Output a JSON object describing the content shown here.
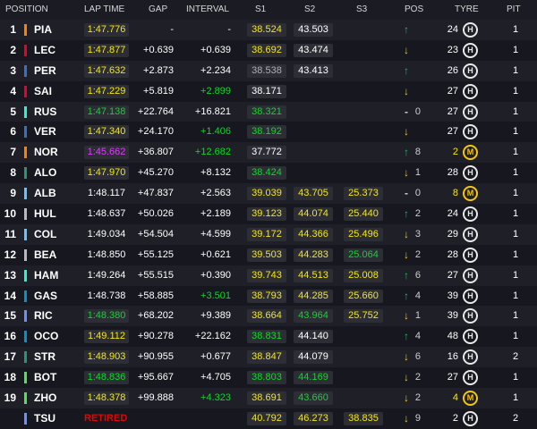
{
  "header": {
    "position": "POSITION",
    "lap_time": "LAP TIME",
    "gap": "GAP",
    "interval": "INTERVAL",
    "s1": "S1",
    "s2": "S2",
    "s3": "S3",
    "pos": "POS",
    "tyre": "TYRE",
    "pit": "PIT"
  },
  "colors": {
    "team": {
      "PIA": "#ff8000",
      "LEC": "#e8002d",
      "PER": "#3671c6",
      "SAI": "#e8002d",
      "RUS": "#27f4d2",
      "VER": "#3671c6",
      "NOR": "#ff8000",
      "ALO": "#229971",
      "ALB": "#64c4ff",
      "HUL": "#b6babd",
      "COL": "#64c4ff",
      "BEA": "#b6babd",
      "HAM": "#27f4d2",
      "GAS": "#0093cc",
      "RIC": "#6692ff",
      "OCO": "#0093cc",
      "STR": "#229971",
      "BOT": "#52e252",
      "ZHO": "#52e252",
      "TSU": "#6692ff"
    },
    "yellow": "#f5e900",
    "green": "#00e020",
    "purple": "#e03cff"
  },
  "rows": [
    {
      "pos": "1",
      "driver": "PIA",
      "lap": "1:47.776",
      "lap_c": "yellow",
      "gap": "-",
      "gap_c": "white",
      "int": "-",
      "int_c": "white",
      "s1": "38.524",
      "s1_c": "yellow",
      "s2": "43.503",
      "s2_c": "white",
      "s3": "",
      "s3_c": "white",
      "arrow": "↑",
      "dir": "up",
      "chg": "",
      "age": "24",
      "tyre": "H",
      "pit": "1"
    },
    {
      "pos": "2",
      "driver": "LEC",
      "lap": "1:47.877",
      "lap_c": "yellow",
      "gap": "+0.639",
      "gap_c": "white",
      "int": "+0.639",
      "int_c": "white",
      "s1": "38.692",
      "s1_c": "yellow",
      "s2": "43.474",
      "s2_c": "white",
      "s3": "",
      "s3_c": "white",
      "arrow": "↓",
      "dir": "down",
      "chg": "",
      "age": "23",
      "tyre": "H",
      "pit": "1"
    },
    {
      "pos": "3",
      "driver": "PER",
      "lap": "1:47.632",
      "lap_c": "yellow",
      "gap": "+2.873",
      "gap_c": "white",
      "int": "+2.234",
      "int_c": "white",
      "s1": "38.538",
      "s1_c": "gray",
      "s2": "43.413",
      "s2_c": "white",
      "s3": "",
      "s3_c": "white",
      "arrow": "↑",
      "dir": "up",
      "chg": "",
      "age": "26",
      "tyre": "H",
      "pit": "1"
    },
    {
      "pos": "4",
      "driver": "SAI",
      "lap": "1:47.229",
      "lap_c": "yellow",
      "gap": "+5.819",
      "gap_c": "white",
      "int": "+2.899",
      "int_c": "green",
      "s1": "38.171",
      "s1_c": "white",
      "s2": "",
      "s2_c": "white",
      "s3": "",
      "s3_c": "white",
      "arrow": "↓",
      "dir": "down",
      "chg": "",
      "age": "27",
      "tyre": "H",
      "pit": "1"
    },
    {
      "pos": "5",
      "driver": "RUS",
      "lap": "1:47.138",
      "lap_c": "green",
      "gap": "+22.764",
      "gap_c": "white",
      "int": "+16.821",
      "int_c": "white",
      "s1": "38.321",
      "s1_c": "green",
      "s2": "",
      "s2_c": "white",
      "s3": "",
      "s3_c": "white",
      "arrow": "-",
      "dir": "same",
      "chg": "0",
      "age": "27",
      "tyre": "H",
      "pit": "1"
    },
    {
      "pos": "6",
      "driver": "VER",
      "lap": "1:47.340",
      "lap_c": "yellow",
      "gap": "+24.170",
      "gap_c": "white",
      "int": "+1.406",
      "int_c": "green",
      "s1": "38.192",
      "s1_c": "green",
      "s2": "",
      "s2_c": "white",
      "s3": "",
      "s3_c": "white",
      "arrow": "↓",
      "dir": "down",
      "chg": "",
      "age": "27",
      "tyre": "H",
      "pit": "1"
    },
    {
      "pos": "7",
      "driver": "NOR",
      "lap": "1:45.662",
      "lap_c": "purple",
      "gap": "+36.807",
      "gap_c": "white",
      "int": "+12.682",
      "int_c": "green",
      "s1": "37.772",
      "s1_c": "white",
      "s2": "",
      "s2_c": "white",
      "s3": "",
      "s3_c": "white",
      "arrow": "↑",
      "dir": "up",
      "chg": "8",
      "age": "2",
      "tyre": "M",
      "pit": "1"
    },
    {
      "pos": "8",
      "driver": "ALO",
      "lap": "1:47.970",
      "lap_c": "yellow",
      "gap": "+45.270",
      "gap_c": "white",
      "int": "+8.132",
      "int_c": "white",
      "s1": "38.424",
      "s1_c": "green",
      "s2": "",
      "s2_c": "white",
      "s3": "",
      "s3_c": "white",
      "arrow": "↓",
      "dir": "down",
      "chg": "1",
      "age": "28",
      "tyre": "H",
      "pit": "1"
    },
    {
      "pos": "9",
      "driver": "ALB",
      "lap": "1:48.117",
      "lap_c": "white",
      "gap": "+47.837",
      "gap_c": "white",
      "int": "+2.563",
      "int_c": "white",
      "s1": "39.039",
      "s1_c": "yellow",
      "s2": "43.705",
      "s2_c": "yellow",
      "s3": "25.373",
      "s3_c": "yellow",
      "arrow": "-",
      "dir": "same",
      "chg": "0",
      "age": "8",
      "tyre": "M",
      "pit": "1"
    },
    {
      "pos": "10",
      "driver": "HUL",
      "lap": "1:48.637",
      "lap_c": "white",
      "gap": "+50.026",
      "gap_c": "white",
      "int": "+2.189",
      "int_c": "white",
      "s1": "39.123",
      "s1_c": "yellow",
      "s2": "44.074",
      "s2_c": "yellow",
      "s3": "25.440",
      "s3_c": "yellow",
      "arrow": "↑",
      "dir": "up",
      "chg": "2",
      "age": "24",
      "tyre": "H",
      "pit": "1"
    },
    {
      "pos": "11",
      "driver": "COL",
      "lap": "1:49.034",
      "lap_c": "white",
      "gap": "+54.504",
      "gap_c": "white",
      "int": "+4.599",
      "int_c": "white",
      "s1": "39.172",
      "s1_c": "yellow",
      "s2": "44.366",
      "s2_c": "yellow",
      "s3": "25.496",
      "s3_c": "yellow",
      "arrow": "↓",
      "dir": "down",
      "chg": "3",
      "age": "29",
      "tyre": "H",
      "pit": "1"
    },
    {
      "pos": "12",
      "driver": "BEA",
      "lap": "1:48.850",
      "lap_c": "white",
      "gap": "+55.125",
      "gap_c": "white",
      "int": "+0.621",
      "int_c": "white",
      "s1": "39.503",
      "s1_c": "yellow",
      "s2": "44.283",
      "s2_c": "yellow",
      "s3": "25.064",
      "s3_c": "green",
      "arrow": "↓",
      "dir": "down",
      "chg": "2",
      "age": "28",
      "tyre": "H",
      "pit": "1"
    },
    {
      "pos": "13",
      "driver": "HAM",
      "lap": "1:49.264",
      "lap_c": "white",
      "gap": "+55.515",
      "gap_c": "white",
      "int": "+0.390",
      "int_c": "white",
      "s1": "39.743",
      "s1_c": "yellow",
      "s2": "44.513",
      "s2_c": "yellow",
      "s3": "25.008",
      "s3_c": "yellow",
      "arrow": "↑",
      "dir": "up",
      "chg": "6",
      "age": "27",
      "tyre": "H",
      "pit": "1"
    },
    {
      "pos": "14",
      "driver": "GAS",
      "lap": "1:48.738",
      "lap_c": "white",
      "gap": "+58.885",
      "gap_c": "white",
      "int": "+3.501",
      "int_c": "green",
      "s1": "38.793",
      "s1_c": "yellow",
      "s2": "44.285",
      "s2_c": "yellow",
      "s3": "25.660",
      "s3_c": "yellow",
      "arrow": "↑",
      "dir": "up",
      "chg": "4",
      "age": "39",
      "tyre": "H",
      "pit": "1"
    },
    {
      "pos": "15",
      "driver": "RIC",
      "lap": "1:48.380",
      "lap_c": "green",
      "gap": "+68.202",
      "gap_c": "white",
      "int": "+9.389",
      "int_c": "white",
      "s1": "38.664",
      "s1_c": "yellow",
      "s2": "43.964",
      "s2_c": "green",
      "s3": "25.752",
      "s3_c": "yellow",
      "arrow": "↓",
      "dir": "down",
      "chg": "1",
      "age": "39",
      "tyre": "H",
      "pit": "1"
    },
    {
      "pos": "16",
      "driver": "OCO",
      "lap": "1:49.112",
      "lap_c": "yellow",
      "gap": "+90.278",
      "gap_c": "white",
      "int": "+22.162",
      "int_c": "white",
      "s1": "38.831",
      "s1_c": "green",
      "s2": "44.140",
      "s2_c": "white",
      "s3": "",
      "s3_c": "white",
      "arrow": "↑",
      "dir": "up",
      "chg": "4",
      "age": "48",
      "tyre": "H",
      "pit": "1"
    },
    {
      "pos": "17",
      "driver": "STR",
      "lap": "1:48.903",
      "lap_c": "yellow",
      "gap": "+90.955",
      "gap_c": "white",
      "int": "+0.677",
      "int_c": "white",
      "s1": "38.847",
      "s1_c": "yellow",
      "s2": "44.079",
      "s2_c": "white",
      "s3": "",
      "s3_c": "white",
      "arrow": "↓",
      "dir": "down",
      "chg": "6",
      "age": "16",
      "tyre": "H",
      "pit": "2"
    },
    {
      "pos": "18",
      "driver": "BOT",
      "lap": "1:48.836",
      "lap_c": "green",
      "gap": "+95.667",
      "gap_c": "white",
      "int": "+4.705",
      "int_c": "white",
      "s1": "38.803",
      "s1_c": "green",
      "s2": "44.169",
      "s2_c": "green",
      "s3": "",
      "s3_c": "white",
      "arrow": "↓",
      "dir": "down",
      "chg": "2",
      "age": "27",
      "tyre": "H",
      "pit": "1"
    },
    {
      "pos": "19",
      "driver": "ZHO",
      "lap": "1:48.378",
      "lap_c": "yellow",
      "gap": "+99.888",
      "gap_c": "white",
      "int": "+4.323",
      "int_c": "green",
      "s1": "38.691",
      "s1_c": "yellow",
      "s2": "43.660",
      "s2_c": "green",
      "s3": "",
      "s3_c": "white",
      "arrow": "↓",
      "dir": "down",
      "chg": "2",
      "age": "4",
      "tyre": "M",
      "pit": "1"
    },
    {
      "pos": "",
      "driver": "TSU",
      "lap": "RETIRED",
      "lap_c": "retired",
      "gap": "",
      "gap_c": "white",
      "int": "",
      "int_c": "white",
      "s1": "40.792",
      "s1_c": "yellow",
      "s2": "46.273",
      "s2_c": "yellow",
      "s3": "38.835",
      "s3_c": "yellow",
      "arrow": "↓",
      "dir": "down",
      "chg": "9",
      "age": "2",
      "tyre": "H",
      "pit": "2"
    }
  ]
}
